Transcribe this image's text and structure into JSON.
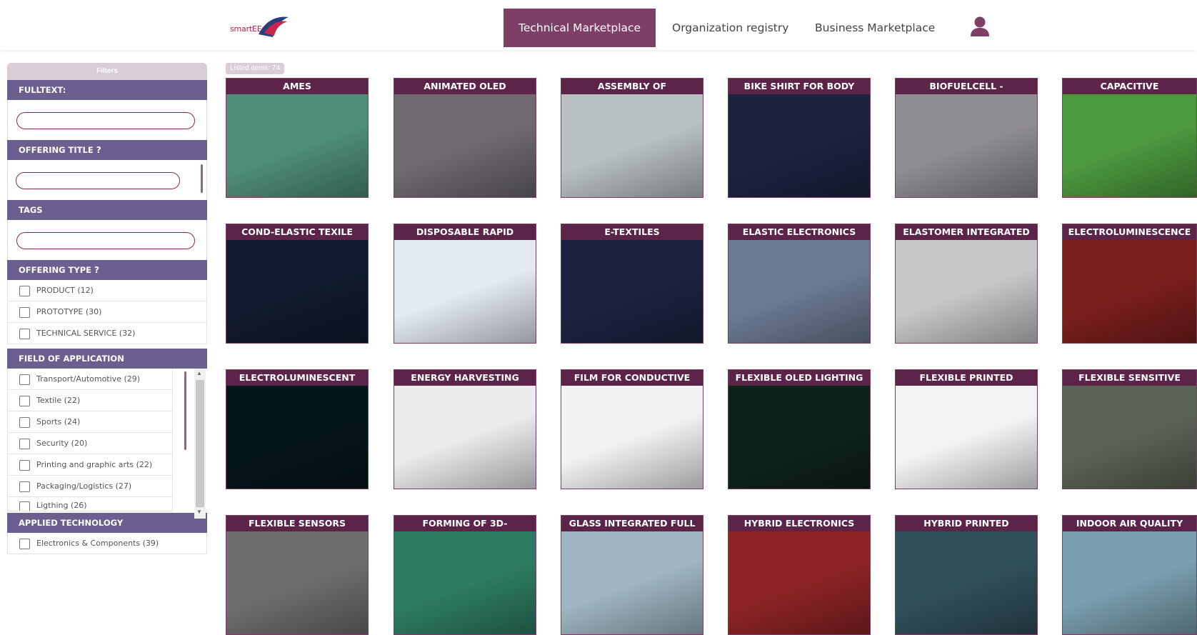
{
  "header": {
    "logo_text": "smartEEs",
    "nav": {
      "technical": "Technical Marketplace",
      "organization": "Organization registry",
      "business": "Business Marketplace"
    }
  },
  "sidebar": {
    "filters_title": "Filters",
    "fulltext_label": "FULLTEXT:",
    "offering_title_label": "OFFERING TITLE",
    "tags_label": "TAGS",
    "offering_type_label": "OFFERING TYPE",
    "help_mark": "?",
    "offering_types": [
      "PRODUCT (12)",
      "PROTOTYPE (30)",
      "TECHNICAL SERVICE (32)"
    ],
    "field_of_application_label": "FIELD OF APPLICATION",
    "fields": [
      "Transport/Automotive (29)",
      "Textile (22)",
      "Sports (24)",
      "Security (20)",
      "Printing and graphic arts (22)",
      "Packaging/Logistics (27)",
      "Ligthing (26)"
    ],
    "applied_technology_label": "APPLIED TECHNOLOGY",
    "technologies": [
      "Electronics & Components (39)"
    ]
  },
  "listing": {
    "count_text": "Listed items: 74",
    "cards": [
      {
        "title": "AMES",
        "bg": "#4f8f78"
      },
      {
        "title": "ANIMATED OLED",
        "bg": "#6e6a70"
      },
      {
        "title": "ASSEMBLY OF",
        "bg": "#b9c0c3"
      },
      {
        "title": "BIKE SHIRT FOR BODY",
        "bg": "#1c2340"
      },
      {
        "title": "BIOFUELCELL -",
        "bg": "#8f8c92"
      },
      {
        "title": "CAPACITIVE",
        "bg": "#4c9a3e"
      },
      {
        "title": "COND-ELASTIC TEXILE",
        "bg": "#101a2e"
      },
      {
        "title": "DISPOSABLE RAPID",
        "bg": "#e4eaf2"
      },
      {
        "title": "E-TEXTILES",
        "bg": "#1c2340"
      },
      {
        "title": "ELASTIC ELECTRONICS",
        "bg": "#6b7a92"
      },
      {
        "title": "ELASTOMER INTEGRATED",
        "bg": "#c7c6c8"
      },
      {
        "title": "ELECTROLUMINESCENCE",
        "bg": "#7a1f1c"
      },
      {
        "title": "ELECTROLUMINESCENT",
        "bg": "#05161b"
      },
      {
        "title": "ENERGY HARVESTING",
        "bg": "#eceaea"
      },
      {
        "title": "FILM FOR CONDUCTIVE",
        "bg": "#f1f2f4"
      },
      {
        "title": "FLEXIBLE OLED LIGHTING",
        "bg": "#0d2319"
      },
      {
        "title": "FLEXIBLE PRINTED",
        "bg": "#f3f3f3"
      },
      {
        "title": "FLEXIBLE SENSITIVE",
        "bg": "#5b6256"
      },
      {
        "title": "FLEXIBLE SENSORS",
        "bg": "#6c6e70"
      },
      {
        "title": "FORMING OF 3D-",
        "bg": "#2e7d62"
      },
      {
        "title": "GLASS INTEGRATED FULL",
        "bg": "#9fb6c2"
      },
      {
        "title": "HYBRID ELECTRONICS",
        "bg": "#8d2424"
      },
      {
        "title": "HYBRID PRINTED",
        "bg": "#2f4f5a"
      },
      {
        "title": "INDOOR AIR QUALITY",
        "bg": "#7a9fae"
      }
    ]
  },
  "colors": {
    "accent": "#7e3f67",
    "card_title": "#5c2448",
    "section_head": "#6a5f8e"
  }
}
